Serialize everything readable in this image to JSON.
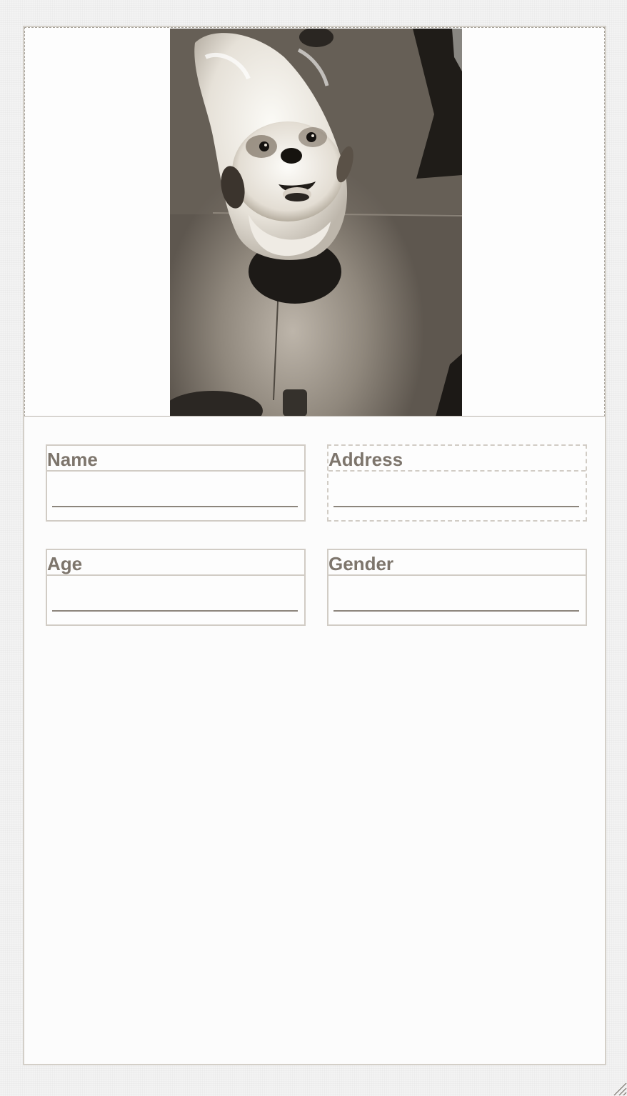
{
  "form": {
    "fields": [
      {
        "id": "name",
        "label": "Name",
        "value": ""
      },
      {
        "id": "address",
        "label": "Address",
        "value": ""
      },
      {
        "id": "age",
        "label": "Age",
        "value": ""
      },
      {
        "id": "gender",
        "label": "Gender",
        "value": ""
      }
    ]
  },
  "photo": {
    "icon": "dog-photo"
  },
  "colors": {
    "label_text": "#7d756c",
    "field_border": "#d1ccc5",
    "underline": "#8c857c",
    "panel_bg": "#fcfcfc"
  },
  "icons": {
    "resize_grip": "resize-grip-icon"
  }
}
